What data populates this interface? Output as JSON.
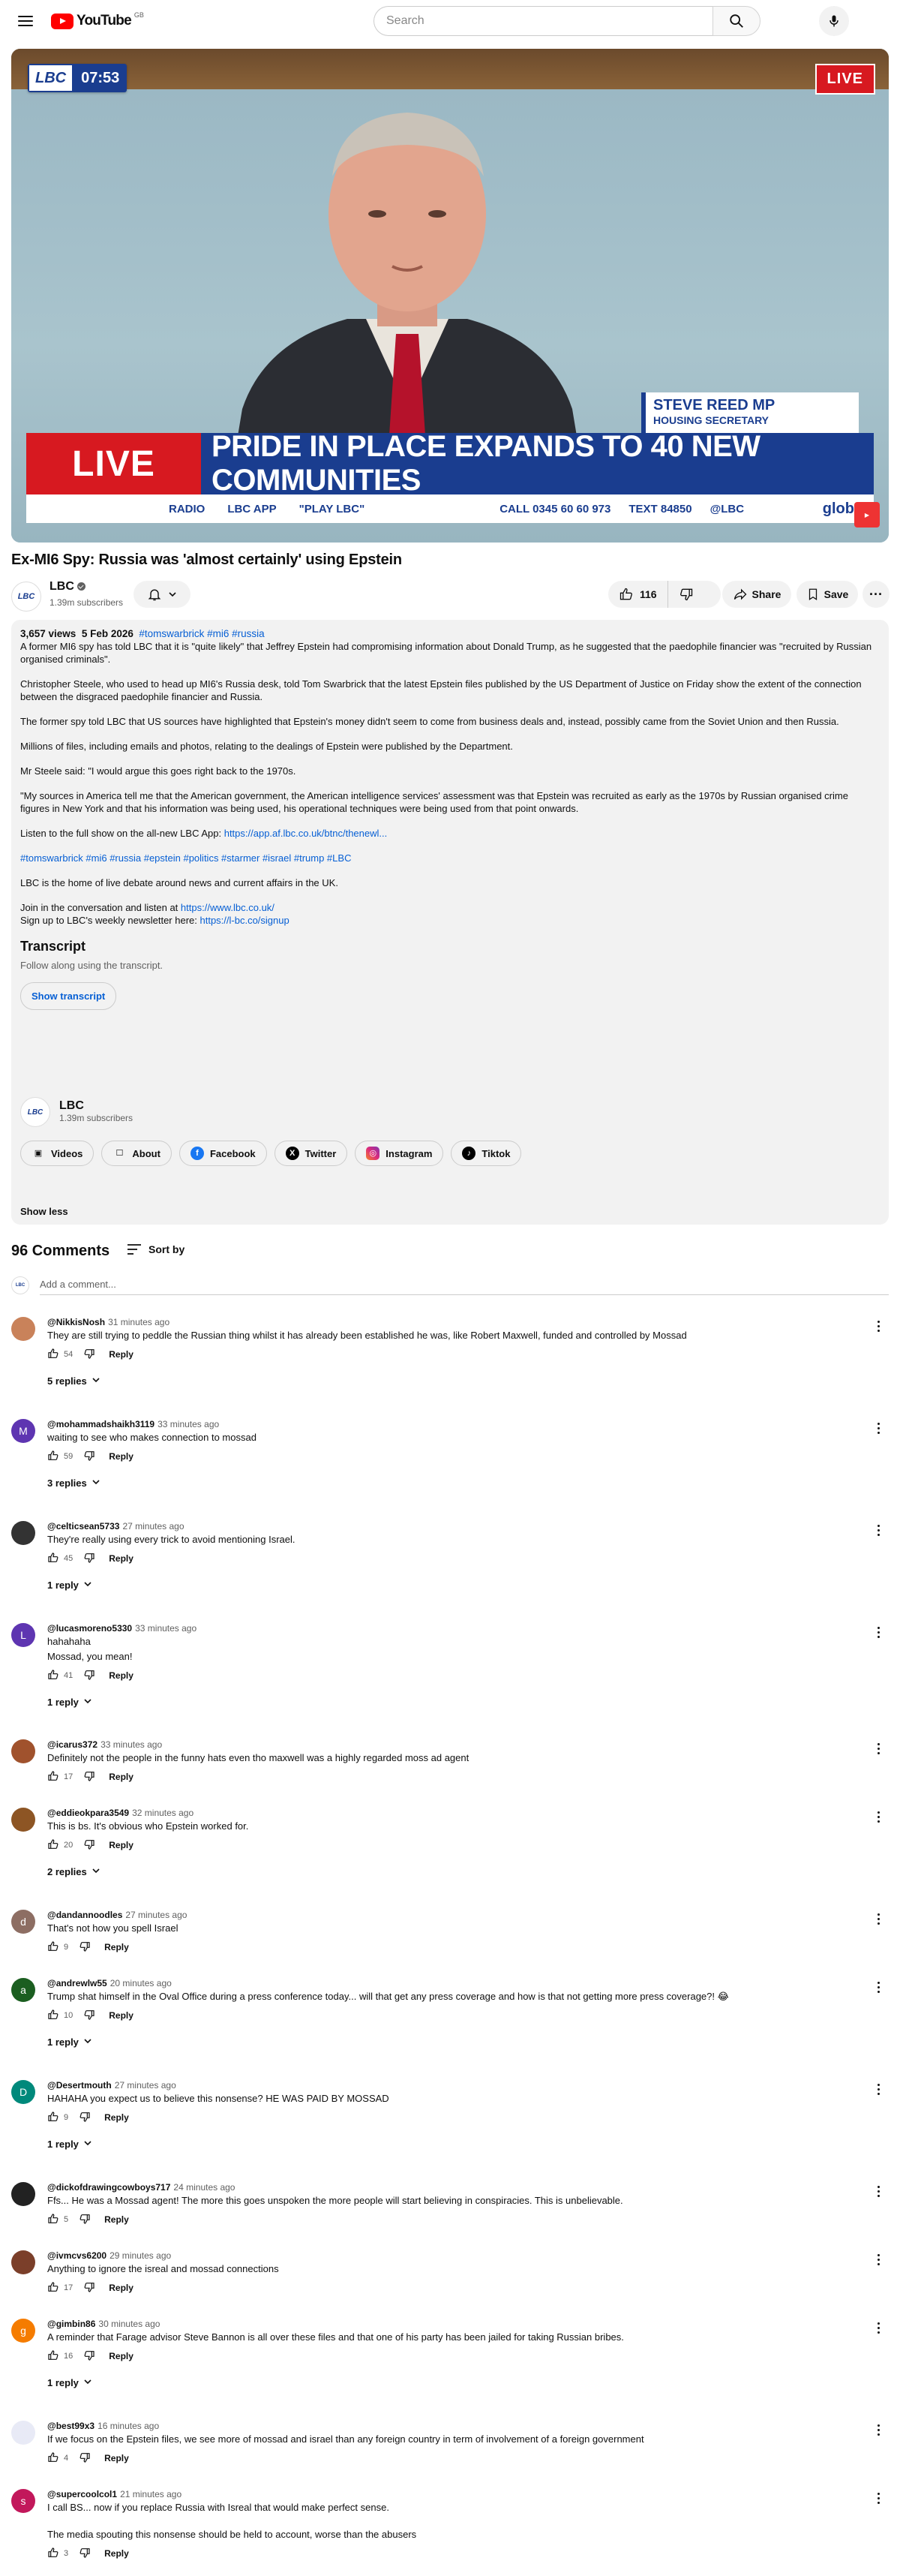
{
  "header": {
    "logo_text": "YouTube",
    "country": "GB",
    "search_placeholder": "Search"
  },
  "player": {
    "lbc_logo": "LBC",
    "clock": "07:53",
    "live_badge": "LIVE",
    "name_caption": "STEVE REED MP",
    "role_caption": "HOUSING SECRETARY",
    "ticker_live": "LIVE",
    "ticker_headline": "PRIDE IN PLACE EXPANDS TO 40 NEW COMMUNITIES",
    "bar_radio": "RADIO",
    "bar_app": "LBC APP",
    "bar_play": "\"PLAY LBC\"",
    "bar_call": "CALL 0345 60 60 973",
    "bar_text": "TEXT 84850",
    "bar_handle": "@LBC",
    "bar_brand": "glob"
  },
  "video": {
    "title": "Ex-MI6 Spy: Russia was 'almost certainly' using Epstein",
    "channel": "LBC",
    "subscribers": "1.39m subscribers",
    "likes": "116",
    "share": "Share",
    "save": "Save"
  },
  "description": {
    "views": "3,657 views",
    "date": "5 Feb 2026",
    "tags_top": "#tomswarbrick #mi6 #russia",
    "p1": "A former MI6 spy has told LBC that it is \"quite likely\" that Jeffrey Epstein had compromising information about Donald Trump, as he suggested that the paedophile financier was \"recruited by Russian organised criminals\".",
    "p2": "Christopher Steele, who used to head up MI6's Russia desk, told Tom Swarbrick that the latest Epstein files published by the US Department of Justice on Friday show the extent of the connection between the disgraced paedophile financier and Russia.",
    "p3": "The former spy told LBC that US sources have highlighted that Epstein's money didn't seem to come from business deals and, instead, possibly came from the Soviet Union and then Russia.",
    "p4": "Millions of files, including emails and photos, relating to the dealings of Epstein were published by the Department.",
    "p5": "Mr Steele said: \"I would argue this goes right back to the 1970s.",
    "p6": "\"My sources in America tell me that the American government, the American intelligence services' assessment was that Epstein was recruited as early as the 1970s by Russian organised crime figures in New York and that his information was being used, his operational techniques were being used from that point onwards.",
    "listen_prefix": "Listen to the full show on the all-new LBC App: ",
    "listen_link": "https://app.af.lbc.co.uk/btnc/thenewl...",
    "tags_bottom": "#tomswarbrick #mi6 #russia #epstein #politics #starmer #israel #trump #LBC",
    "p7": "LBC is the home of live debate around news and current affairs in the UK.",
    "join_prefix": "Join in the conversation and listen at ",
    "join_link": "https://www.lbc.co.uk/",
    "signup_prefix": "Sign up to LBC's weekly newsletter here: ",
    "signup_link": "https://l-bc.co/signup",
    "transcript_title": "Transcript",
    "transcript_sub": "Follow along using the transcript.",
    "show_transcript": "Show transcript",
    "channel": "LBC",
    "subscribers": "1.39m subscribers",
    "social": [
      "Videos",
      "About",
      "Facebook",
      "Twitter",
      "Instagram",
      "Tiktok"
    ],
    "show_less": "Show less"
  },
  "comments_header": {
    "count": "96 Comments",
    "sort": "Sort by",
    "add_placeholder": "Add a comment..."
  },
  "comments": [
    {
      "author": "@NikkisNosh",
      "time": "31 minutes ago",
      "text": "They are still trying to peddle the Russian thing whilst it has already been established he was, like Robert Maxwell, funded and controlled by Mossad",
      "likes": "54",
      "replies": "5 replies",
      "avatar_color": "#c9825a",
      "initial": ""
    },
    {
      "author": "@mohammadshaikh3119",
      "time": "33 minutes ago",
      "text": "waiting to see who makes connection to mossad",
      "likes": "59",
      "replies": "3 replies",
      "avatar_color": "#5e35b1",
      "initial": "M"
    },
    {
      "author": "@celticsean5733",
      "time": "27 minutes ago",
      "text": "They're really using every trick to avoid mentioning Israel.",
      "likes": "45",
      "replies": "1 reply",
      "avatar_color": "#333333",
      "initial": ""
    },
    {
      "author": "@lucasmoreno5330",
      "time": "33 minutes ago",
      "text": "hahahaha",
      "text2": "Mossad, you mean!",
      "likes": "41",
      "replies": "1 reply",
      "avatar_color": "#5e35b1",
      "initial": "L"
    },
    {
      "author": "@icarus372",
      "time": "33 minutes ago",
      "text": "Definitely not the people in the funny hats even tho maxwell was a highly regarded moss ad agent",
      "likes": "17",
      "replies": "",
      "avatar_color": "#a0522d",
      "initial": ""
    },
    {
      "author": "@eddieokpara3549",
      "time": "32 minutes ago",
      "text": "This is bs. It's obvious who Epstein worked for.",
      "likes": "20",
      "replies": "2 replies",
      "avatar_color": "#8d5524",
      "initial": ""
    },
    {
      "author": "@dandannoodles",
      "time": "27 minutes ago",
      "text": "That's not how you spell Israel",
      "likes": "9",
      "replies": "",
      "avatar_color": "#8d6e63",
      "initial": "d"
    },
    {
      "author": "@andrewlw55",
      "time": "20 minutes ago",
      "text": "Trump shat himself in the Oval Office during a press conference today... will that get any press coverage and how is that not getting more press coverage?! 😂",
      "likes": "10",
      "replies": "1 reply",
      "avatar_color": "#1b5e20",
      "initial": "a"
    },
    {
      "author": "@Desertmouth",
      "time": "27 minutes ago",
      "text": "HAHAHA you expect us to believe this nonsense? HE WAS PAID BY MOSSAD",
      "likes": "9",
      "replies": "1 reply",
      "avatar_color": "#00897b",
      "initial": "D"
    },
    {
      "author": "@dickofdrawingcowboys717",
      "time": "24 minutes ago",
      "text": "Ffs... He was a Mossad agent! The more this goes unspoken the more people will start believing in conspiracies. This is unbelievable.",
      "likes": "5",
      "replies": "",
      "avatar_color": "#222222",
      "initial": ""
    },
    {
      "author": "@ivmcvs6200",
      "time": "29 minutes ago",
      "text": "Anything to ignore the isreal and mossad connections",
      "likes": "17",
      "replies": "",
      "avatar_color": "#7b3f2a",
      "initial": ""
    },
    {
      "author": "@gimbin86",
      "time": "30 minutes ago",
      "text": "A reminder that Farage advisor Steve Bannon is all over these files and that one of his party has been jailed for taking Russian bribes.",
      "likes": "16",
      "replies": "1 reply",
      "avatar_color": "#f57c00",
      "initial": "g"
    },
    {
      "author": "@best99x3",
      "time": "16 minutes ago",
      "text": "If we focus on the Epstein files, we see more of mossad and israel than any foreign country in term of involvement of a foreign government",
      "likes": "4",
      "replies": "",
      "avatar_color": "#e8eaf6",
      "initial": ""
    },
    {
      "author": "@supercoolcol1",
      "time": "21 minutes ago",
      "text": "I call BS... now if you replace Russia with Isreal that would make perfect sense.",
      "text2": "The media spouting this nonsense should be held to account, worse than the abusers",
      "likes": "3",
      "replies": "",
      "avatar_color": "#c2185b",
      "initial": "s"
    }
  ]
}
